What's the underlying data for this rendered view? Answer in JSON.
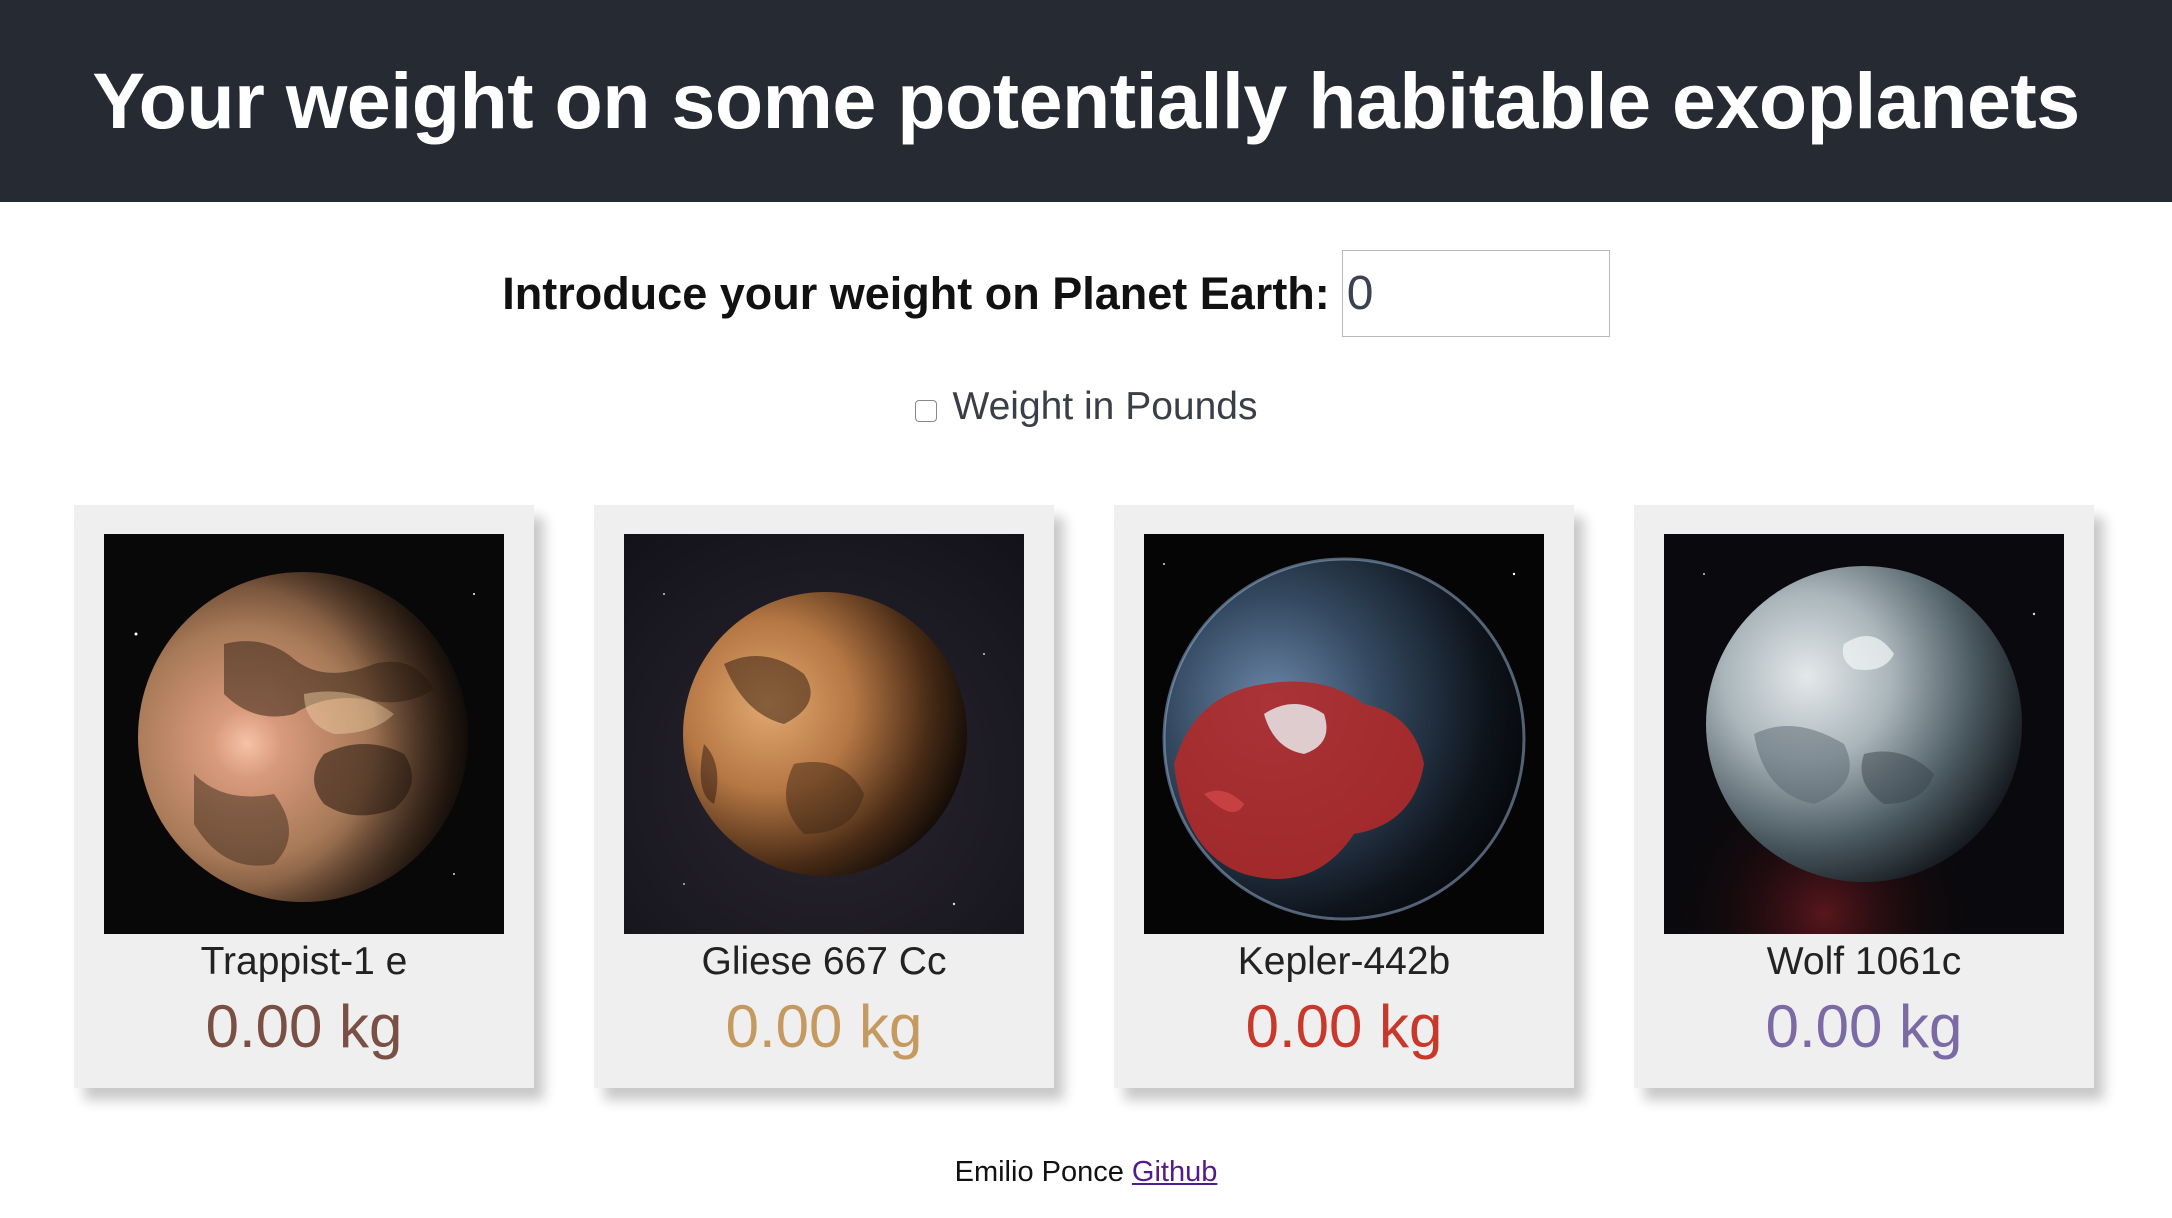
{
  "header": {
    "title": "Your weight on some potentially habitable exoplanets"
  },
  "form": {
    "label": "Introduce your weight on Planet Earth:",
    "value": "0",
    "checkbox_label": "Weight in Pounds",
    "checkbox_checked": false
  },
  "planets": [
    {
      "name": "Trappist-1 e",
      "weight": "0.00 kg",
      "color": "#7a4f44"
    },
    {
      "name": "Gliese 667 Cc",
      "weight": "0.00 kg",
      "color": "#c49a60"
    },
    {
      "name": "Kepler-442b",
      "weight": "0.00 kg",
      "color": "#c8392b"
    },
    {
      "name": "Wolf 1061c",
      "weight": "0.00 kg",
      "color": "#7b6aa4"
    }
  ],
  "footer": {
    "author": "Emilio Ponce",
    "link_label": "Github"
  }
}
